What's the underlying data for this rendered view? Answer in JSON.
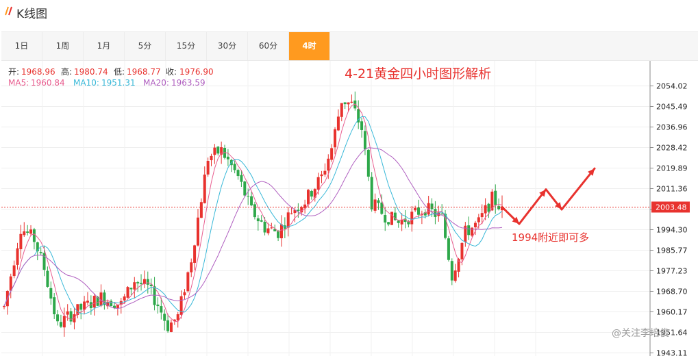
{
  "header": {
    "logo_mark": "//",
    "title": "K线图"
  },
  "tabs": [
    {
      "label": "1日",
      "active": false
    },
    {
      "label": "1周",
      "active": false
    },
    {
      "label": "1月",
      "active": false
    },
    {
      "label": "5分",
      "active": false
    },
    {
      "label": "15分",
      "active": false
    },
    {
      "label": "30分",
      "active": false
    },
    {
      "label": "60分",
      "active": false
    },
    {
      "label": "4时",
      "active": true
    }
  ],
  "info": {
    "open_label": "开:",
    "open_value": "1968.96",
    "high_label": "高:",
    "high_value": "1980.74",
    "low_label": "低:",
    "low_value": "1968.77",
    "close_label": "收:",
    "close_value": "1976.90",
    "ma5_label": "MA5:",
    "ma5_value": "1960.84",
    "ma10_label": "MA10:",
    "ma10_value": "1951.31",
    "ma20_label": "MA20:",
    "ma20_value": "1963.59"
  },
  "colors": {
    "up": "#e8322e",
    "down": "#2ea84a",
    "ma5": "#e85d8f",
    "ma10": "#38b8d8",
    "ma20": "#b060c0",
    "annotation": "#e8322e",
    "price_tag_bg": "#e8322e"
  },
  "annotation": {
    "title": "4-21黄金四小时图形解析",
    "note": "1994附近即可多",
    "projection": [
      2003.5,
      1996.5,
      2010.8,
      2002.5,
      2019.5
    ]
  },
  "watermark": "@关注李培俊",
  "chart_data": {
    "type": "candlestick",
    "y_ticks": [
      2054.02,
      2045.49,
      2036.96,
      2028.42,
      2019.89,
      2011.36,
      2002.83,
      1994.3,
      1985.77,
      1977.23,
      1968.7,
      1960.17,
      1951.64,
      1943.11
    ],
    "y_tick_labels": [
      "2054.02",
      "2045.49",
      "2036.96",
      "2028.42",
      "2019.89",
      "2011.36",
      "2002.83",
      "1994.30",
      "1985.77",
      "1977.23",
      "1968.70",
      "1960.17",
      "1951.64",
      "1943.11"
    ],
    "ylim": [
      1941.6,
      2064.2
    ],
    "current_price": 2003.48,
    "current_price_label": "2003.48",
    "anchors": [
      [
        0,
        1962
      ],
      [
        5,
        1995
      ],
      [
        9,
        1990
      ],
      [
        12,
        1978
      ],
      [
        16,
        1954
      ],
      [
        19,
        1958
      ],
      [
        24,
        1962
      ],
      [
        29,
        1966
      ],
      [
        35,
        1963
      ],
      [
        39,
        1973
      ],
      [
        43,
        1970
      ],
      [
        46,
        1963
      ],
      [
        49,
        1954
      ],
      [
        52,
        1958
      ],
      [
        56,
        1982
      ],
      [
        61,
        2024
      ],
      [
        65,
        2027
      ],
      [
        70,
        2016
      ],
      [
        74,
        2002
      ],
      [
        78,
        1995
      ],
      [
        82,
        1993
      ],
      [
        86,
        2002
      ],
      [
        90,
        2006
      ],
      [
        95,
        2016
      ],
      [
        98,
        2028
      ],
      [
        101,
        2048
      ],
      [
        104,
        2046
      ],
      [
        107,
        2036
      ],
      [
        110,
        2005
      ],
      [
        114,
        2000
      ],
      [
        118,
        1997
      ],
      [
        122,
        2000
      ],
      [
        126,
        2003
      ],
      [
        131,
        1999
      ],
      [
        134,
        1975
      ],
      [
        138,
        1993
      ],
      [
        142,
        1997
      ],
      [
        146,
        2007
      ],
      [
        149,
        2003
      ]
    ]
  }
}
